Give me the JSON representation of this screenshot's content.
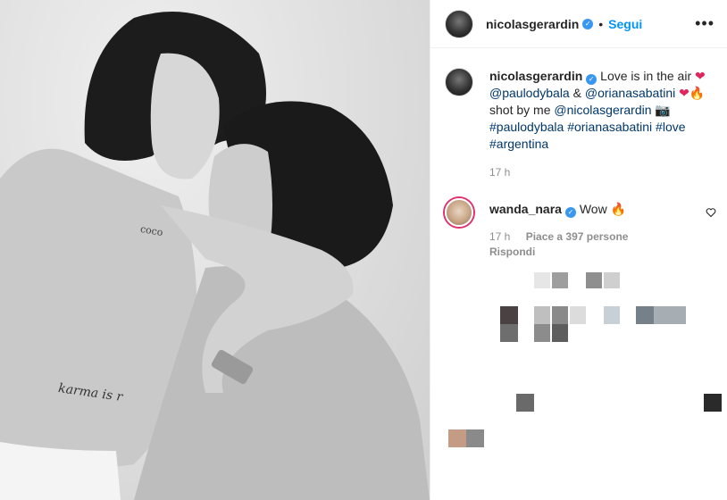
{
  "post": {
    "author": "nicolasgerardin",
    "follow_label": "Segui",
    "dot": "•",
    "more_label": "•••"
  },
  "caption": {
    "author": "nicolasgerardin",
    "text1": "Love is in the air",
    "mention1": "@paulodybala",
    "amp": "&",
    "mention2": "@orianasabatini",
    "text2": "shot by me",
    "mention3": "@nicolasgerardin",
    "tag1": "#paulodybala",
    "tag2": "#orianasabatini",
    "tag3": "#love",
    "tag4": "#argentina",
    "time": "17 h"
  },
  "comment": {
    "author": "wanda_nara",
    "text": "Wow",
    "time": "17 h",
    "likes": "Piace a 397 persone",
    "reply": "Rispondi"
  },
  "photo": {
    "tattoo1": "coco",
    "tattoo2": "karma is r"
  },
  "icons": {
    "heart": "heart-icon",
    "fire": "fire-icon",
    "camera": "camera-icon",
    "verified": "verified-badge-icon"
  }
}
